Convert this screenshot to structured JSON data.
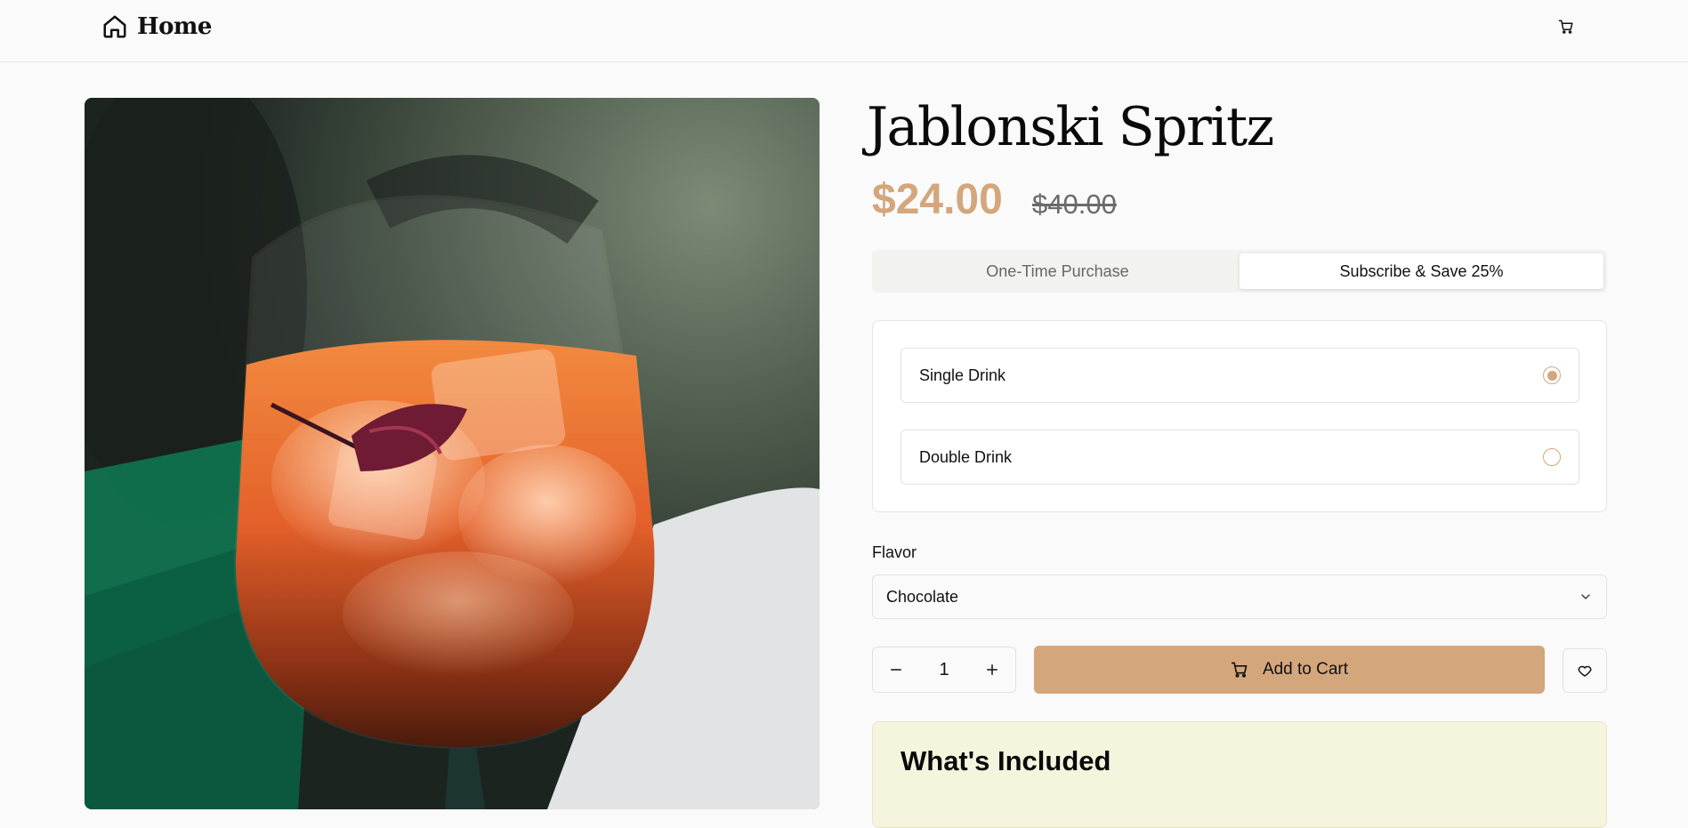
{
  "header": {
    "home_label": "Home",
    "home_icon": "home-icon",
    "cart_icon": "cart-icon"
  },
  "product": {
    "title": "Jablonski Spritz",
    "price": "$24.00",
    "original_price": "$40.00",
    "image_description_icon": "cocktail-image"
  },
  "purchase_tabs": [
    {
      "label": "One-Time Purchase",
      "active": false
    },
    {
      "label": "Subscribe & Save 25%",
      "active": true
    }
  ],
  "size_options": [
    {
      "label": "Single Drink",
      "selected": true
    },
    {
      "label": "Double Drink",
      "selected": false
    }
  ],
  "flavor": {
    "label": "Flavor",
    "selected": "Chocolate"
  },
  "quantity": {
    "value": "1"
  },
  "actions": {
    "add_to_cart_label": "Add to Cart",
    "wishlist_icon": "heart-icon"
  },
  "included": {
    "title": "What's Included"
  },
  "colors": {
    "accent": "#d4a67c",
    "included_bg": "#f5f4dc",
    "text": "#111111"
  }
}
